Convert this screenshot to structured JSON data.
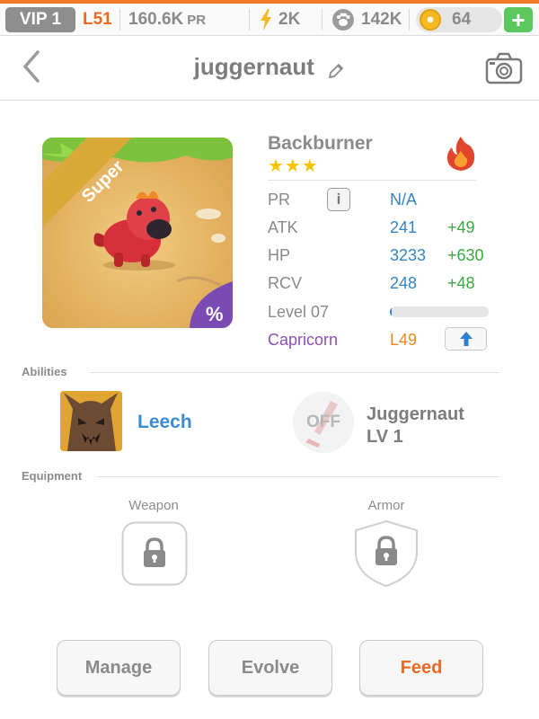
{
  "topbar": {
    "vip": "VIP 1",
    "level": "L51",
    "pr_value": "160.6K",
    "pr_suffix": "PR",
    "energy": "2K",
    "paws": "142K",
    "coins": "64",
    "plus": "+"
  },
  "header": {
    "title": "juggernaut"
  },
  "monster": {
    "rarity": "Super",
    "name": "Backburner",
    "stars": "★★★",
    "element": "fire",
    "stats": {
      "pr_label": "PR",
      "info": "i",
      "pr_value": "N/A",
      "atk_label": "ATK",
      "atk_value": "241",
      "atk_bonus": "+49",
      "hp_label": "HP",
      "hp_value": "3233",
      "hp_bonus": "+630",
      "rcv_label": "RCV",
      "rcv_value": "248",
      "rcv_bonus": "+48",
      "level_label": "Level 07",
      "xp_progress": 0.01,
      "sign_label": "Capricorn",
      "sign_level": "L49"
    }
  },
  "abilities": {
    "heading": "Abilities",
    "ability_name": "Leech",
    "off_label": "OFF",
    "ultimate_name": "Juggernaut",
    "ultimate_level": "LV 1"
  },
  "equipment": {
    "heading": "Equipment",
    "weapon_label": "Weapon",
    "armor_label": "Armor"
  },
  "buttons": {
    "manage": "Manage",
    "evolve": "Evolve",
    "feed": "Feed"
  },
  "colors": {
    "accent_orange": "#f47a2a",
    "stat_blue": "#3385c6",
    "bonus_green": "#3ba842",
    "sign_purple": "#8c4fb3",
    "plus_green": "#5ac85c"
  }
}
